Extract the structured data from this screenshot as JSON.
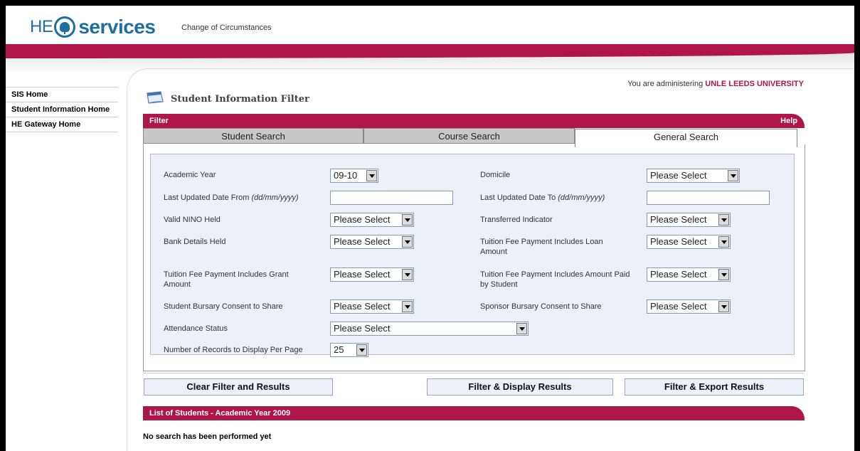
{
  "header": {
    "logo_he": "HE",
    "logo_services": "services",
    "subtitle": "Change of Circumstances"
  },
  "sidebar": {
    "items": [
      {
        "label": "SIS Home"
      },
      {
        "label": "Student Information Home"
      },
      {
        "label": "HE Gateway Home"
      }
    ]
  },
  "admin": {
    "prefix": "You are administering",
    "institution": "UNLE LEEDS UNIVERSITY"
  },
  "page": {
    "title": "Student Information Filter"
  },
  "filter_bar": {
    "label": "Filter",
    "help": "Help"
  },
  "tabs": [
    {
      "label": "Student Search"
    },
    {
      "label": "Course Search"
    },
    {
      "label": "General Search",
      "active": true
    }
  ],
  "form": {
    "academic_year": {
      "label": "Academic Year",
      "value": "09-10"
    },
    "domicile": {
      "label": "Domicile",
      "value": "Please Select"
    },
    "date_from": {
      "label": "Last Updated Date From",
      "hint": "(dd/mm/yyyy)",
      "value": ""
    },
    "date_to": {
      "label": "Last Updated Date To",
      "hint": "(dd/mm/yyyy)",
      "value": ""
    },
    "valid_nino": {
      "label": "Valid NINO Held",
      "value": "Please Select"
    },
    "transferred": {
      "label": "Transferred Indicator",
      "value": "Please Select"
    },
    "bank_details": {
      "label": "Bank Details Held",
      "value": "Please Select"
    },
    "fee_loan": {
      "label": "Tuition Fee Payment Includes Loan Amount",
      "value": "Please Select"
    },
    "fee_grant": {
      "label": "Tuition Fee Payment Includes Grant Amount",
      "value": "Please Select"
    },
    "fee_student": {
      "label": "Tuition Fee Payment Includes Amount Paid by Student",
      "value": "Please Select"
    },
    "student_bursary": {
      "label": "Student Bursary Consent to Share",
      "value": "Please Select"
    },
    "sponsor_bursary": {
      "label": "Sponsor Bursary Consent to Share",
      "value": "Please Select"
    },
    "attendance": {
      "label": "Attendance Status",
      "value": "Please Select"
    },
    "records_per_page": {
      "label": "Number of Records to Display Per Page",
      "value": "25"
    }
  },
  "buttons": {
    "clear": "Clear Filter and Results",
    "display": "Filter & Display Results",
    "export": "Filter & Export Results"
  },
  "results": {
    "bar_title": "List of Students - Academic Year 2009",
    "message": "No search has been performed yet"
  },
  "colors": {
    "brand": "#b0154a",
    "logo_blue": "#1d6fa0"
  }
}
